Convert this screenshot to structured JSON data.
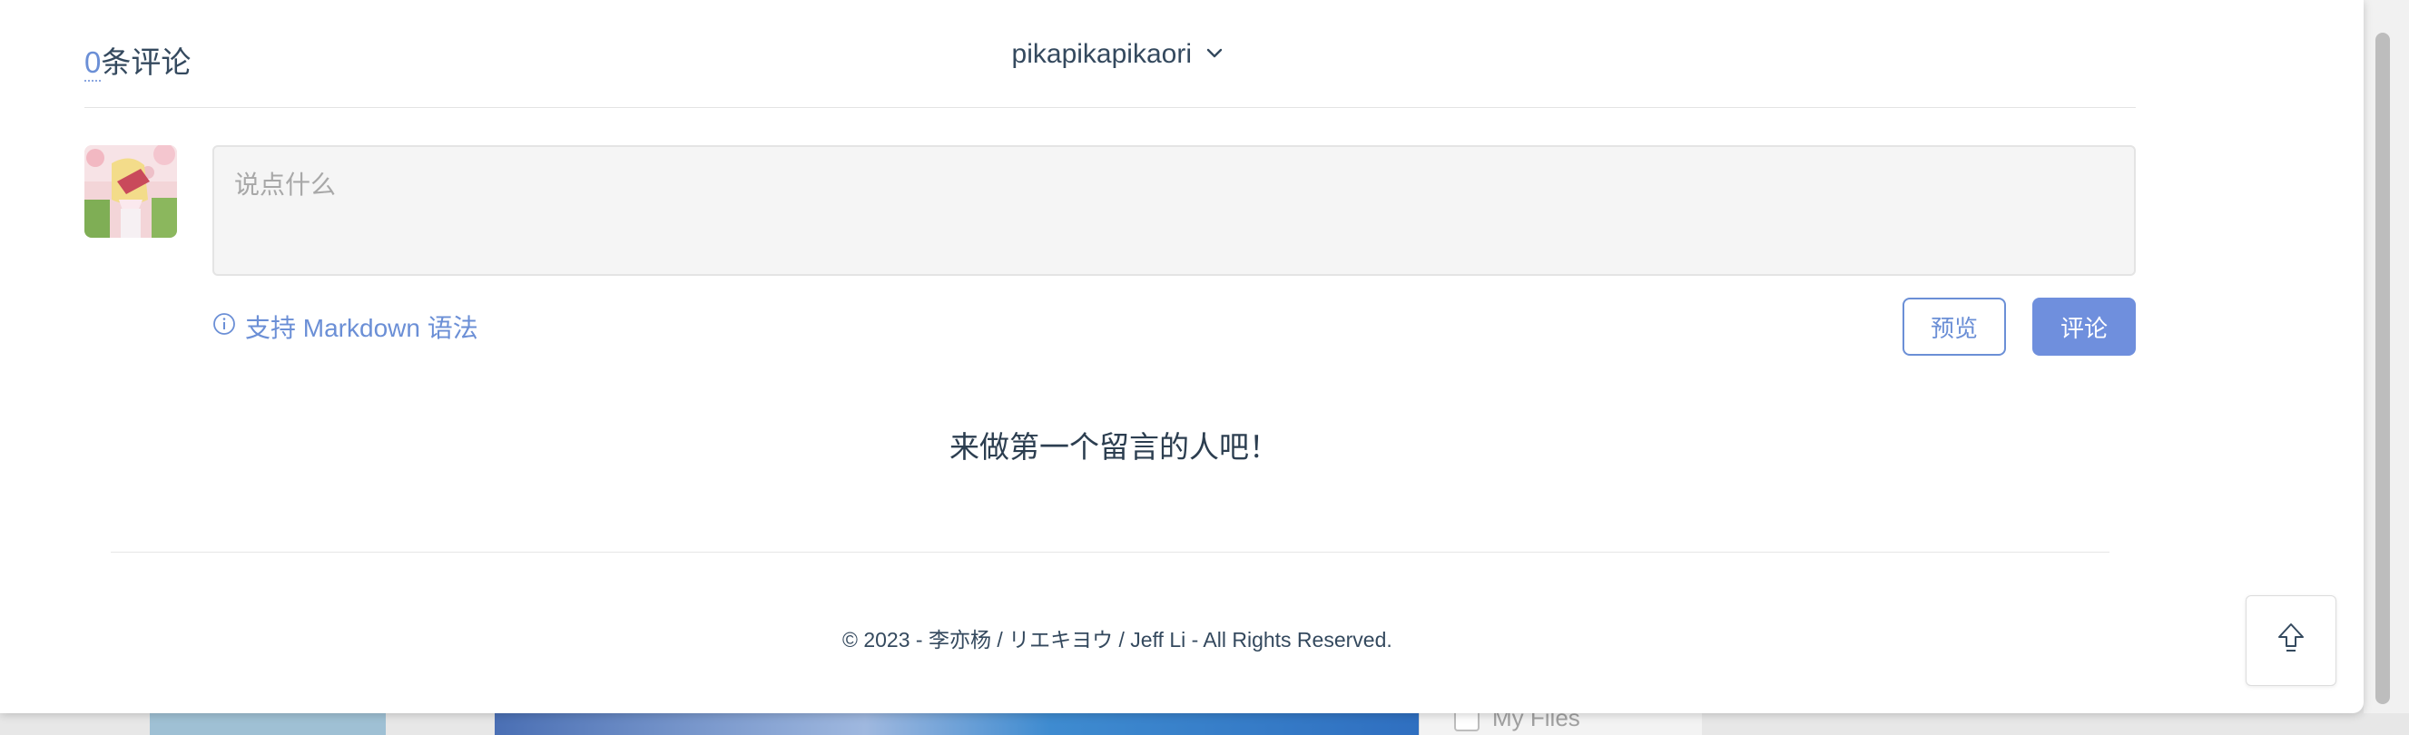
{
  "comments": {
    "count": "0",
    "count_suffix": "条评论",
    "username": "pikapikapikaori",
    "user_menu_icon": "chevron-down-icon",
    "input_placeholder": "说点什么",
    "markdown_hint": "支持 Markdown 语法",
    "markdown_hint_icon": "info-icon",
    "preview_label": "预览",
    "submit_label": "评论",
    "empty_message": "来做第一个留言的人吧！"
  },
  "footer": {
    "copyright": "© 2023 - 李亦杨 / リエキヨウ / Jeff Li - All Rights Reserved."
  },
  "back_to_top": {
    "icon": "arrow-up-icon"
  },
  "background": {
    "files_label": "My Files"
  },
  "colors": {
    "accent": "#6b8fd6",
    "button_primary": "#6f8fdd",
    "text": "#34495e",
    "input_bg": "#f5f5f5"
  }
}
